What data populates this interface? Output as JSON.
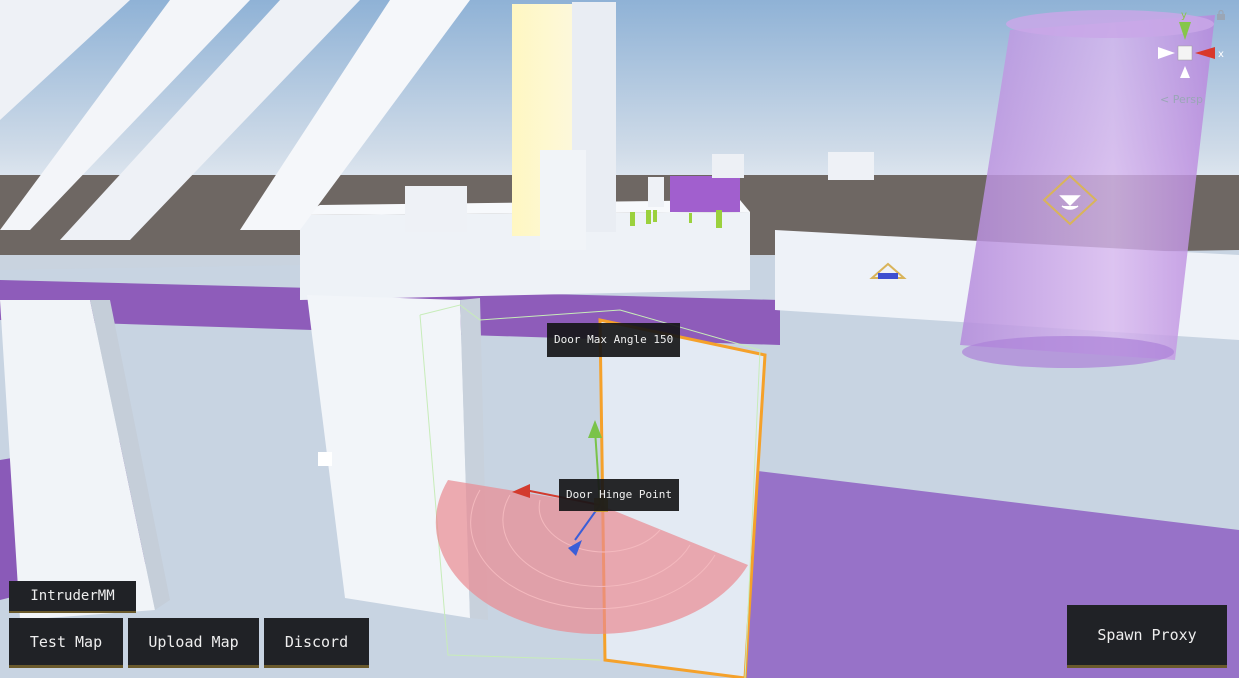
{
  "scene": {
    "tooltip_max_angle": "Door Max Angle 150",
    "tooltip_hinge": "Door Hinge Point"
  },
  "gizmo": {
    "y_label": "y",
    "x_label": "x",
    "projection_label": "< Persp"
  },
  "toolbar": {
    "map_name": "IntruderMM",
    "test_map_label": "Test Map",
    "upload_map_label": "Upload Map",
    "discord_label": "Discord",
    "spawn_proxy_label": "Spawn Proxy"
  },
  "colors": {
    "accent_purple": "#9a5fd0",
    "selection_orange": "#f5a12a",
    "arc_red": "#e88a92",
    "button_bg": "#202226",
    "button_border": "#6a5a2c"
  }
}
